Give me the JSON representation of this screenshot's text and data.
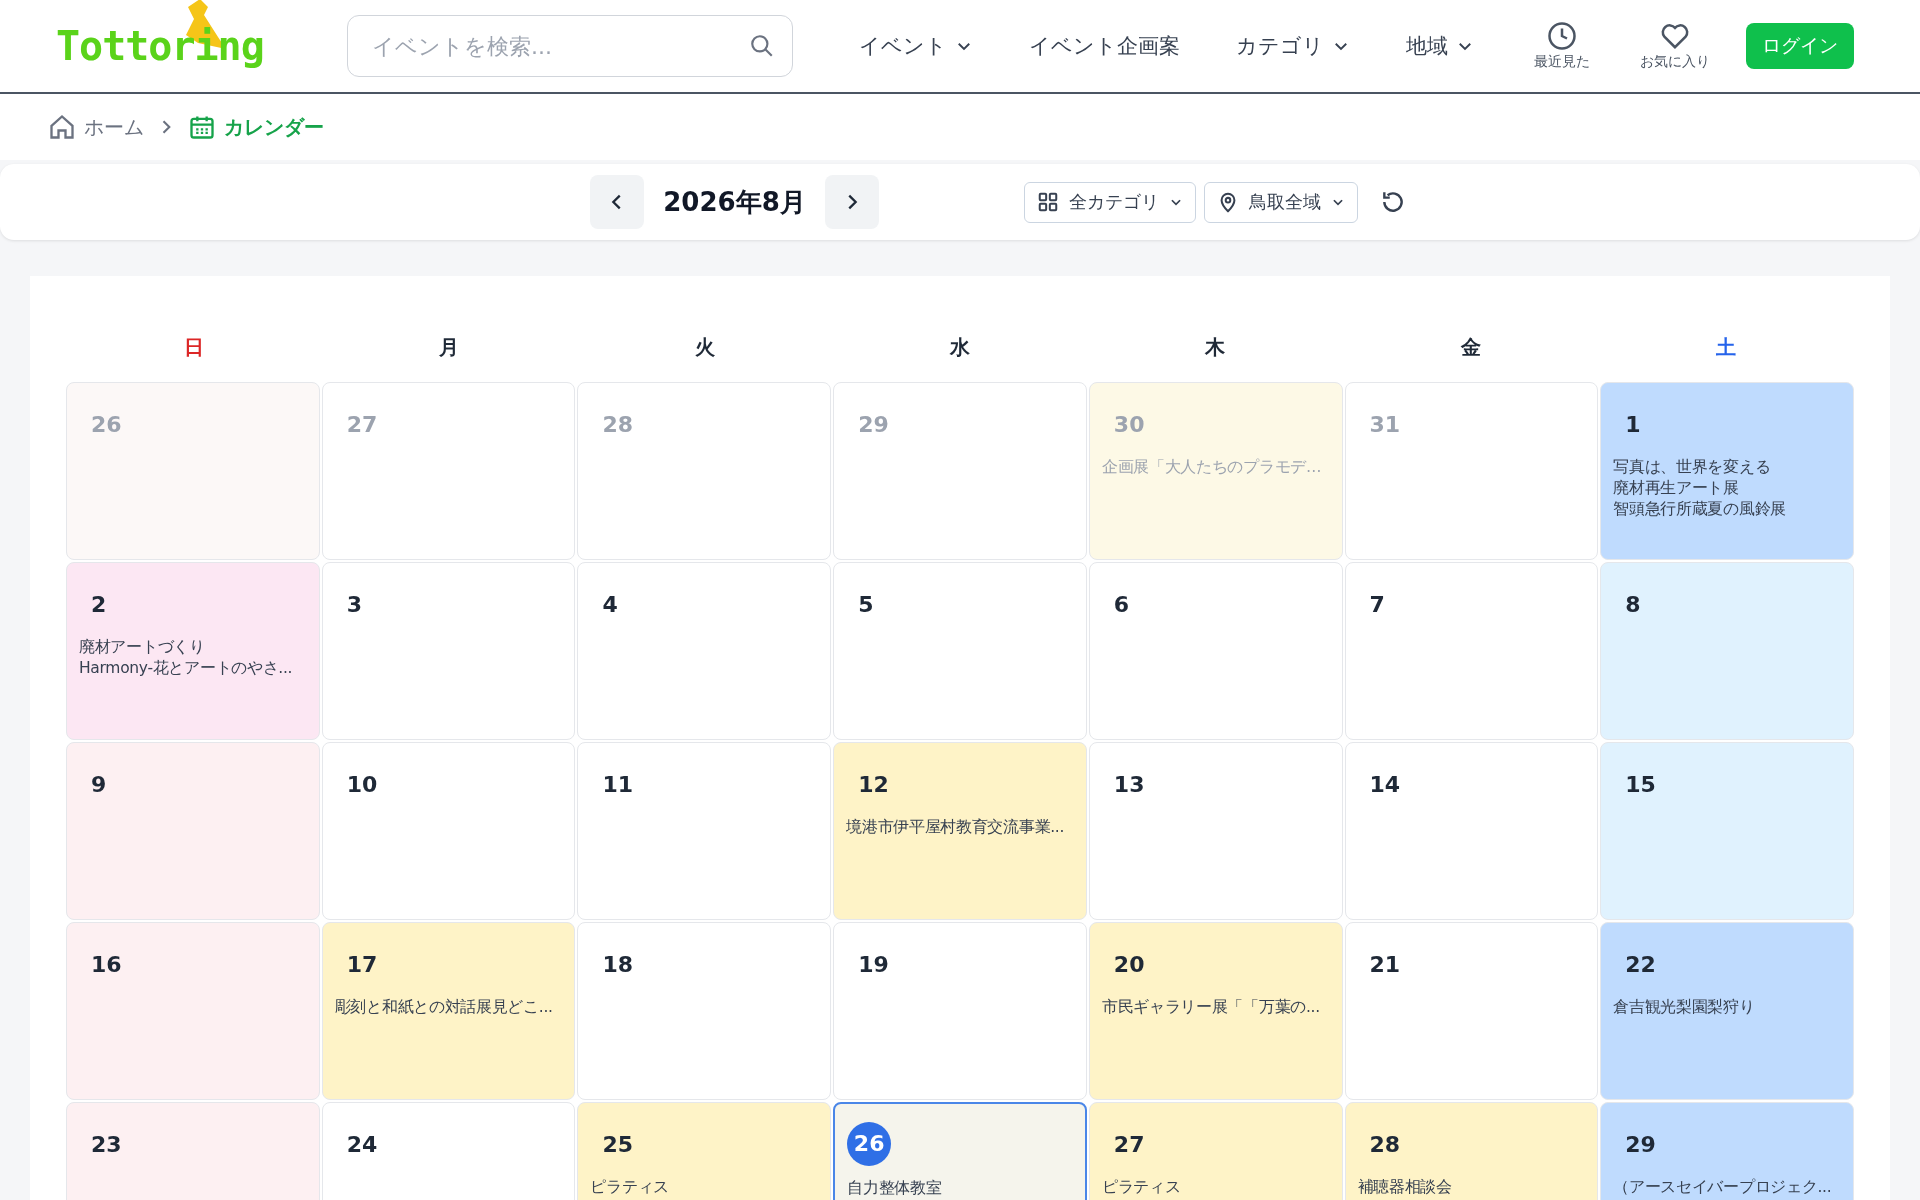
{
  "header": {
    "logo": "Tottoring",
    "search": {
      "placeholder": "イベントを検索..."
    },
    "nav": [
      {
        "label": "イベント",
        "dropdown": true
      },
      {
        "label": "イベント企画案",
        "dropdown": false
      },
      {
        "label": "カテゴリ",
        "dropdown": true
      },
      {
        "label": "地域",
        "dropdown": true
      }
    ],
    "icon_links": [
      {
        "kind": "clock",
        "label": "最近見た"
      },
      {
        "kind": "heart",
        "label": "お気に入り"
      }
    ],
    "login": "ログイン"
  },
  "breadcrumb": [
    {
      "kind": "home",
      "label": "ホーム",
      "selected": false
    },
    {
      "kind": "calendar",
      "label": "カレンダー",
      "selected": true
    }
  ],
  "toolbar": {
    "month": "2026年8月",
    "filters": [
      {
        "kind": "grid",
        "label": "全カテゴリ"
      },
      {
        "kind": "pin",
        "label": "鳥取全域"
      }
    ]
  },
  "weekdays": [
    {
      "label": "日",
      "color": "#dc2626"
    },
    {
      "label": "月",
      "color": "#1f2937"
    },
    {
      "label": "火",
      "color": "#1f2937"
    },
    {
      "label": "水",
      "color": "#1f2937"
    },
    {
      "label": "木",
      "color": "#1f2937"
    },
    {
      "label": "金",
      "color": "#1f2937"
    },
    {
      "label": "土",
      "color": "#2563eb"
    }
  ],
  "days": [
    {
      "date": "26",
      "other_month": true,
      "today": false,
      "color": "#fcf8f7"
    },
    {
      "date": "27",
      "other_month": true,
      "today": false,
      "color": "#ffffff"
    },
    {
      "date": "28",
      "other_month": true,
      "today": false,
      "color": "#ffffff"
    },
    {
      "date": "29",
      "other_month": true,
      "today": false,
      "color": "#ffffff"
    },
    {
      "date": "30",
      "other_month": true,
      "today": false,
      "color": "#fdf9e6",
      "events": [
        "企画展「大人たちのプラモデ…"
      ]
    },
    {
      "date": "31",
      "other_month": true,
      "today": false,
      "color": "#ffffff"
    },
    {
      "date": "1",
      "other_month": false,
      "today": false,
      "color": "#bfdbfe",
      "events": [
        "写真は、世界を変える",
        "廃材再生アート展",
        "智頭急行所蔵夏の風鈴展"
      ]
    },
    {
      "date": "2",
      "other_month": false,
      "today": false,
      "color": "#fce7f3",
      "events": [
        "廃材アートづくり",
        "Harmony-花とアートのやさ..."
      ]
    },
    {
      "date": "3",
      "other_month": false,
      "today": false,
      "color": "#ffffff"
    },
    {
      "date": "4",
      "other_month": false,
      "today": false,
      "color": "#ffffff"
    },
    {
      "date": "5",
      "other_month": false,
      "today": false,
      "color": "#ffffff"
    },
    {
      "date": "6",
      "other_month": false,
      "today": false,
      "color": "#ffffff"
    },
    {
      "date": "7",
      "other_month": false,
      "today": false,
      "color": "#ffffff"
    },
    {
      "date": "8",
      "other_month": false,
      "today": false,
      "color": "#e0f2fe"
    },
    {
      "date": "9",
      "other_month": false,
      "today": false,
      "color": "#fdf0f2"
    },
    {
      "date": "10",
      "other_month": false,
      "today": false,
      "color": "#ffffff"
    },
    {
      "date": "11",
      "other_month": false,
      "today": false,
      "color": "#ffffff"
    },
    {
      "date": "12",
      "other_month": false,
      "today": false,
      "color": "#fef3c7",
      "events": [
        "境港市伊平屋村教育交流事業..."
      ]
    },
    {
      "date": "13",
      "other_month": false,
      "today": false,
      "color": "#ffffff"
    },
    {
      "date": "14",
      "other_month": false,
      "today": false,
      "color": "#ffffff"
    },
    {
      "date": "15",
      "other_month": false,
      "today": false,
      "color": "#e0f2fe"
    },
    {
      "date": "16",
      "other_month": false,
      "today": false,
      "color": "#fdf0f2"
    },
    {
      "date": "17",
      "other_month": false,
      "today": false,
      "color": "#fef3c7",
      "events": [
        "彫刻と和紙との対話展見どこ..."
      ]
    },
    {
      "date": "18",
      "other_month": false,
      "today": false,
      "color": "#ffffff"
    },
    {
      "date": "19",
      "other_month": false,
      "today": false,
      "color": "#ffffff"
    },
    {
      "date": "20",
      "other_month": false,
      "today": false,
      "color": "#fef3c7",
      "events": [
        "市民ギャラリー展「「万葉の..."
      ]
    },
    {
      "date": "21",
      "other_month": false,
      "today": false,
      "color": "#ffffff"
    },
    {
      "date": "22",
      "other_month": false,
      "today": false,
      "color": "#bfdbfe",
      "events": [
        "倉吉観光梨園梨狩り"
      ]
    },
    {
      "date": "23",
      "other_month": false,
      "today": false,
      "color": "#fdf0f2"
    },
    {
      "date": "24",
      "other_month": false,
      "today": false,
      "color": "#ffffff"
    },
    {
      "date": "25",
      "other_month": false,
      "today": false,
      "color": "#fef3c7",
      "events": [
        "ピラティス"
      ]
    },
    {
      "date": "26",
      "other_month": false,
      "today": true,
      "color": "#f5f4ec",
      "events": [
        "自力整体教室"
      ]
    },
    {
      "date": "27",
      "other_month": false,
      "today": false,
      "color": "#fef3c7",
      "events": [
        "ピラティス"
      ]
    },
    {
      "date": "28",
      "other_month": false,
      "today": false,
      "color": "#fef3c7",
      "events": [
        "補聴器相談会"
      ]
    },
    {
      "date": "29",
      "other_month": false,
      "today": false,
      "color": "#bfdbfe",
      "events": [
        "（アースセイバープロジェク..."
      ]
    }
  ]
}
